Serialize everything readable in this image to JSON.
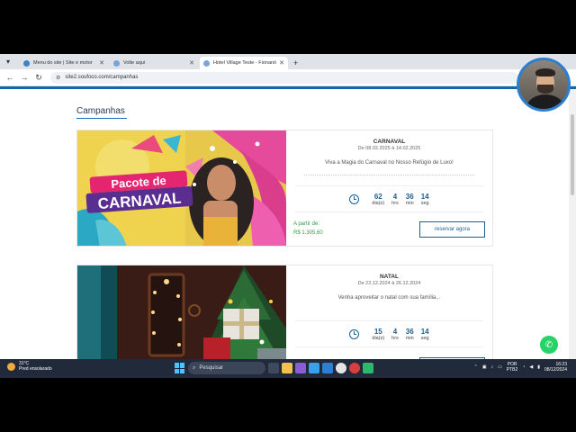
{
  "browser": {
    "tabs": [
      {
        "title": "Menu do site | Site e motor",
        "active": false
      },
      {
        "title": "Volte aqui",
        "active": false
      },
      {
        "title": "Hotel Village Teste - Fionanóp",
        "active": true
      }
    ],
    "url": "site2.soufoco.com/campanhas"
  },
  "page": {
    "section_title": "Campanhas",
    "campaigns": [
      {
        "image_text_1": "Pacote de",
        "image_text_2": "CARNAVAL",
        "title": "CARNAVAL",
        "dates": "De 08.02.2025 à 14.02.2025",
        "description": "Viva a Magia do Carnaval no Nosso Refúgio de Luxo!",
        "countdown": {
          "days": "62",
          "days_label": "dia(s)",
          "hours": "4",
          "hours_label": "hrs",
          "minutes": "36",
          "minutes_label": "min",
          "seconds": "14",
          "seconds_label": "seg"
        },
        "from_label": "A partir de:",
        "price": "R$ 1.305,60",
        "button": "reservar agora"
      },
      {
        "title": "NATAL",
        "dates": "De 22.12.2024 à 26.12.2024",
        "description": "Venha aproveitar o natal com sua família...",
        "countdown": {
          "days": "15",
          "days_label": "dia(s)",
          "hours": "4",
          "hours_label": "hrs",
          "minutes": "36",
          "minutes_label": "min",
          "seconds": "14",
          "seconds_label": "seg"
        }
      }
    ]
  },
  "taskbar": {
    "weather_temp": "31°C",
    "weather_desc": "Pred ensolarado",
    "search_placeholder": "Pesquisar",
    "lang_1": "POR",
    "lang_2": "PTB2",
    "time": "16:23",
    "date": "08/12/2024"
  },
  "colors": {
    "primary": "#1b5f95",
    "price_green": "#2e9e43",
    "whatsapp": "#25d366"
  }
}
